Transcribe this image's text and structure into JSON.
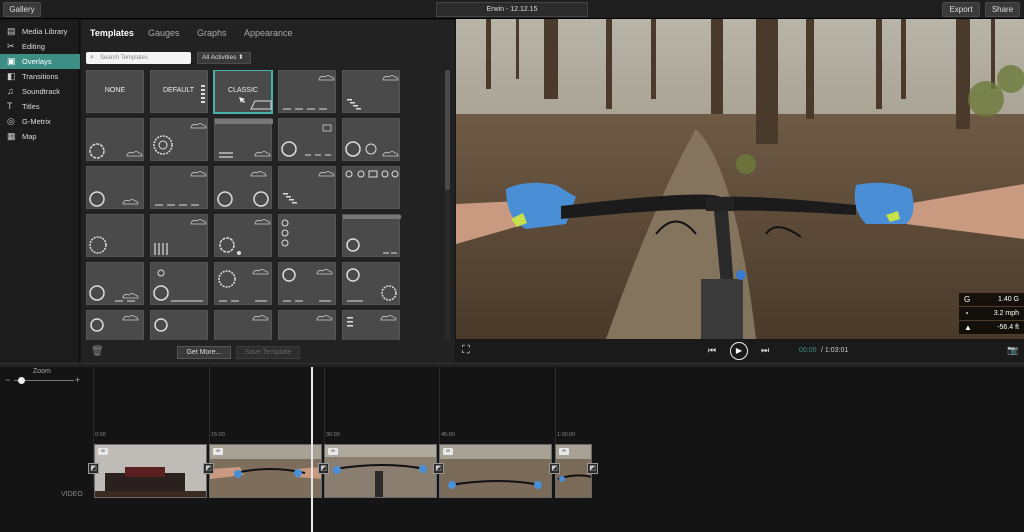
{
  "topbar": {
    "gallery": "Gallery",
    "title": "Erwin - 12.12.15",
    "export": "Export",
    "share": "Share"
  },
  "sidebar": {
    "items": [
      {
        "label": "Media Library",
        "icon": "film-icon",
        "active": false
      },
      {
        "label": "Editing",
        "icon": "scissors-icon",
        "active": false
      },
      {
        "label": "Overlays",
        "icon": "overlay-icon",
        "active": true
      },
      {
        "label": "Transitions",
        "icon": "transitions-icon",
        "active": false
      },
      {
        "label": "Soundtrack",
        "icon": "music-note-icon",
        "active": false
      },
      {
        "label": "Titles",
        "icon": "text-t-icon",
        "active": false
      },
      {
        "label": "G-Metrix",
        "icon": "g-metrix-icon",
        "active": false
      },
      {
        "label": "Map",
        "icon": "map-icon",
        "active": false
      }
    ]
  },
  "panel": {
    "tabs": [
      "Templates",
      "Gauges",
      "Graphs",
      "Appearance"
    ],
    "active_tab": "Templates",
    "search_placeholder": "Search Templates",
    "filter": "All Activities",
    "templates": [
      "NONE",
      "DEFAULT",
      "CLASSIC"
    ],
    "selected_template": "CLASSIC",
    "get_more": "Get More...",
    "save_template": "Save Template"
  },
  "player": {
    "gauges": [
      {
        "value": "1.40 G",
        "icon": "g-force-icon"
      },
      {
        "value": "3.2 mph",
        "icon": "speedometer-icon"
      },
      {
        "value": "-56.4 ft",
        "icon": "elevation-icon"
      }
    ],
    "time_current": "00:00",
    "time_total": "/ 1:03:01"
  },
  "timeline": {
    "zoom_label": "Zoom",
    "zoom_minus": "−",
    "zoom_plus": "+",
    "ticks": [
      "0:00",
      "15:00",
      "30:00",
      "45:00",
      "1:00:00"
    ],
    "track_label": "VIDEO"
  }
}
